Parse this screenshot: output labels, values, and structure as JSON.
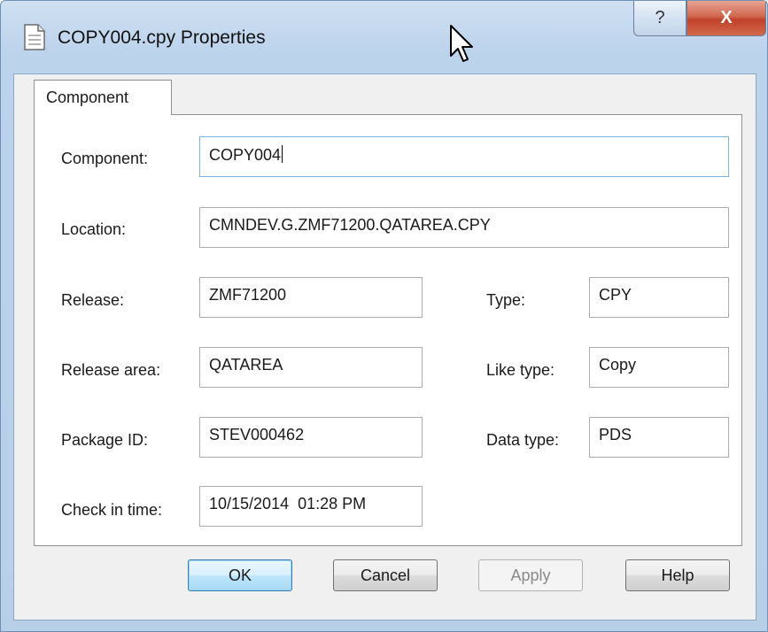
{
  "window": {
    "title": "COPY004.cpy Properties",
    "help_button": "?",
    "close_button": "X"
  },
  "tabs": [
    {
      "label": "Component",
      "selected": true
    }
  ],
  "fields": {
    "component": {
      "label": "Component:",
      "value": "COPY004"
    },
    "location": {
      "label": "Location:",
      "value": "CMNDEV.G.ZMF71200.QATAREA.CPY"
    },
    "release": {
      "label": "Release:",
      "value": "ZMF71200"
    },
    "type": {
      "label": "Type:",
      "value": "CPY"
    },
    "release_area": {
      "label": "Release area:",
      "value": "QATAREA"
    },
    "like_type": {
      "label": "Like type:",
      "value": "Copy"
    },
    "package_id": {
      "label": "Package ID:",
      "value": "STEV000462"
    },
    "data_type": {
      "label": "Data type:",
      "value": "PDS"
    },
    "check_in_time": {
      "label": "Check in time:",
      "value": "10/15/2014  01:28 PM"
    }
  },
  "buttons": {
    "ok": "OK",
    "cancel": "Cancel",
    "apply": "Apply",
    "help": "Help"
  },
  "icons": {
    "title": "document-icon",
    "cursor": "mouse-pointer-icon"
  },
  "colors": {
    "frame": "#bcd3ec",
    "close_button": "#c1412a",
    "default_button": "#a7d9f5"
  }
}
